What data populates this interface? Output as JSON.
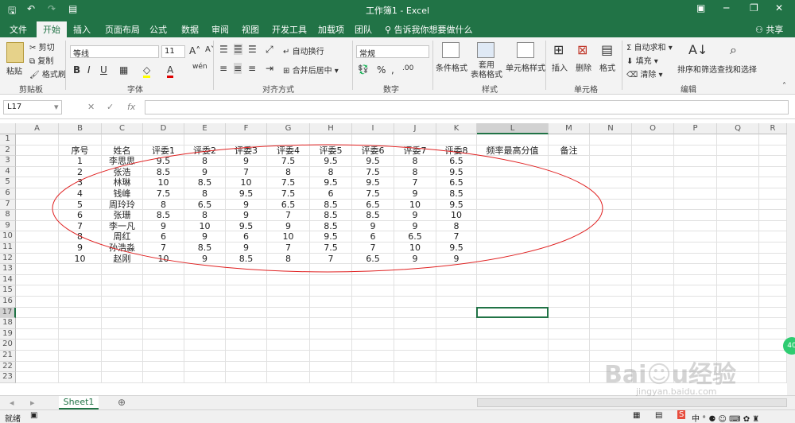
{
  "window": {
    "title": "工作簿1 - Excel",
    "qa_icons": [
      "save-icon",
      "undo-icon",
      "redo-icon",
      "customize-icon"
    ]
  },
  "tabs": [
    "文件",
    "开始",
    "插入",
    "页面布局",
    "公式",
    "数据",
    "审阅",
    "视图",
    "开发工具",
    "加载项",
    "团队"
  ],
  "tell_me": "告诉我你想要做什么",
  "share": "共享",
  "ribbon": {
    "clipboard": {
      "paste": "粘贴",
      "cut": "剪切",
      "copy": "复制",
      "painter": "格式刷",
      "label": "剪贴板"
    },
    "font": {
      "name": "等线",
      "size": "11",
      "bold": "B",
      "italic": "I",
      "underline": "U",
      "label": "字体",
      "wen": "wén"
    },
    "align": {
      "wrap": "自动换行",
      "merge": "合并后居中",
      "label": "对齐方式"
    },
    "number": {
      "format": "常规",
      "percent": "%",
      "comma": ",",
      "inc": ".00",
      "label": "数字"
    },
    "styles": {
      "cond": "条件格式",
      "table": "套用\n表格格式",
      "cell": "单元格样式",
      "label": "样式"
    },
    "cells": {
      "insert": "插入",
      "delete": "删除",
      "format": "格式",
      "label": "单元格"
    },
    "edit": {
      "autosum": "自动求和",
      "fill": "填充",
      "clear": "清除",
      "sort": "排序和筛选",
      "find": "查找和选择",
      "label": "编辑"
    }
  },
  "name_box": "L17",
  "fx": "fx",
  "columns": [
    "A",
    "B",
    "C",
    "D",
    "E",
    "F",
    "G",
    "H",
    "I",
    "J",
    "K",
    "L",
    "M",
    "N",
    "O",
    "P",
    "Q",
    "R"
  ],
  "rows": [
    "1",
    "2",
    "3",
    "4",
    "5",
    "6",
    "7",
    "8",
    "9",
    "10",
    "11",
    "12",
    "13",
    "14",
    "15",
    "16",
    "17",
    "18",
    "19",
    "20",
    "21",
    "22",
    "23"
  ],
  "headers": [
    "序号",
    "姓名",
    "评委1",
    "评委2",
    "评委3",
    "评委4",
    "评委5",
    "评委6",
    "评委7",
    "评委8",
    "频率最高分值",
    "备注"
  ],
  "table": [
    [
      "1",
      "李思思",
      "9.5",
      "8",
      "9",
      "7.5",
      "9.5",
      "9.5",
      "8",
      "6.5"
    ],
    [
      "2",
      "张浩",
      "8.5",
      "9",
      "7",
      "8",
      "8",
      "7.5",
      "8",
      "9.5"
    ],
    [
      "3",
      "林琳",
      "10",
      "8.5",
      "10",
      "7.5",
      "9.5",
      "9.5",
      "7",
      "6.5"
    ],
    [
      "4",
      "钱峰",
      "7.5",
      "8",
      "9.5",
      "7.5",
      "6",
      "7.5",
      "9",
      "8.5"
    ],
    [
      "5",
      "周玲玲",
      "8",
      "6.5",
      "9",
      "6.5",
      "8.5",
      "6.5",
      "10",
      "9.5"
    ],
    [
      "6",
      "张珊",
      "8.5",
      "8",
      "9",
      "7",
      "8.5",
      "8.5",
      "9",
      "10"
    ],
    [
      "7",
      "李一凡",
      "9",
      "10",
      "9.5",
      "9",
      "8.5",
      "9",
      "9",
      "8"
    ],
    [
      "8",
      "周红",
      "6",
      "9",
      "6",
      "10",
      "9.5",
      "6",
      "6.5",
      "7"
    ],
    [
      "9",
      "孙浩淼",
      "7",
      "8.5",
      "9",
      "7",
      "7.5",
      "7",
      "10",
      "9.5"
    ],
    [
      "10",
      "赵刚",
      "10",
      "9",
      "8.5",
      "8",
      "7",
      "6.5",
      "9",
      "9"
    ]
  ],
  "sheet": "Sheet1",
  "status": "就绪",
  "ellipse_color": "#e02020",
  "accent": "#217346",
  "watermark": "Baidu经验 jingyan.baidu.com"
}
